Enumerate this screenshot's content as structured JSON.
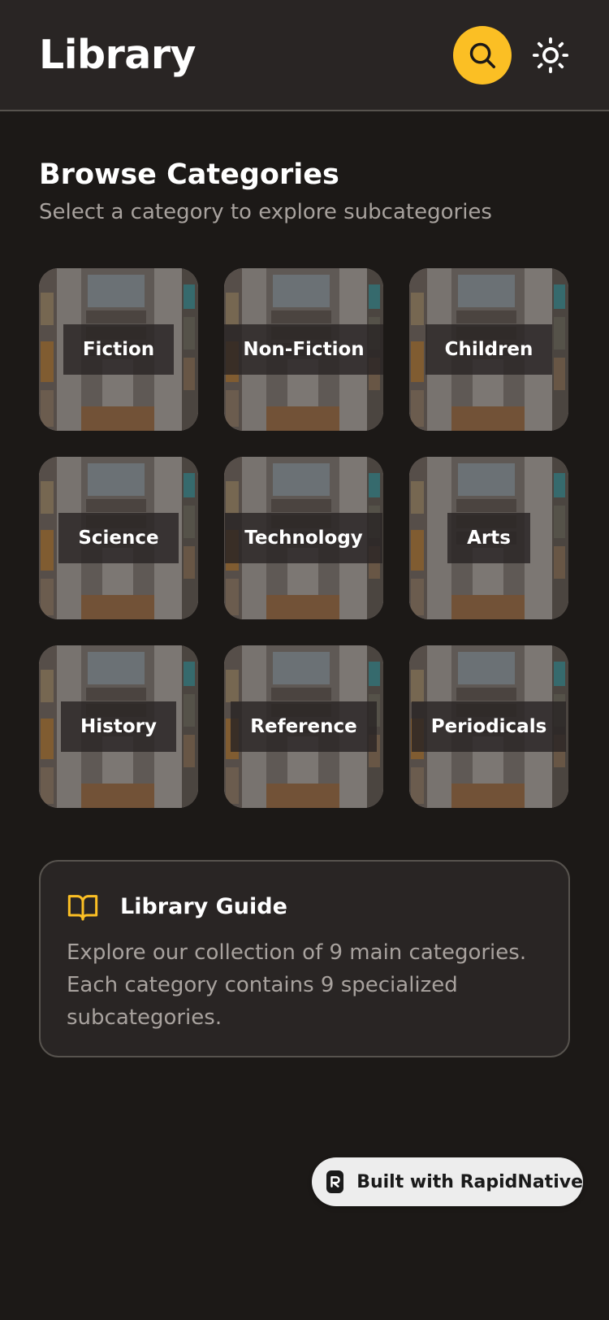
{
  "header": {
    "title": "Library",
    "search_icon": "search-icon",
    "theme_icon": "sun-icon"
  },
  "section": {
    "title": "Browse Categories",
    "subtitle": "Select a category to explore subcategories"
  },
  "categories": [
    {
      "label": "Fiction"
    },
    {
      "label": "Non-Fiction"
    },
    {
      "label": "Children"
    },
    {
      "label": "Science"
    },
    {
      "label": "Technology"
    },
    {
      "label": "Arts"
    },
    {
      "label": "History"
    },
    {
      "label": "Reference"
    },
    {
      "label": "Periodicals"
    }
  ],
  "guide": {
    "icon": "book-open-icon",
    "title": "Library Guide",
    "text": "Explore our collection of 9 main categories. Each category contains 9 specialized subcategories."
  },
  "badge": {
    "label": "Built with RapidNative"
  },
  "colors": {
    "background": "#1c1917",
    "surface": "#292524",
    "accent": "#fbbf24",
    "muted_text": "#a8a29e",
    "border": "#57534e"
  }
}
